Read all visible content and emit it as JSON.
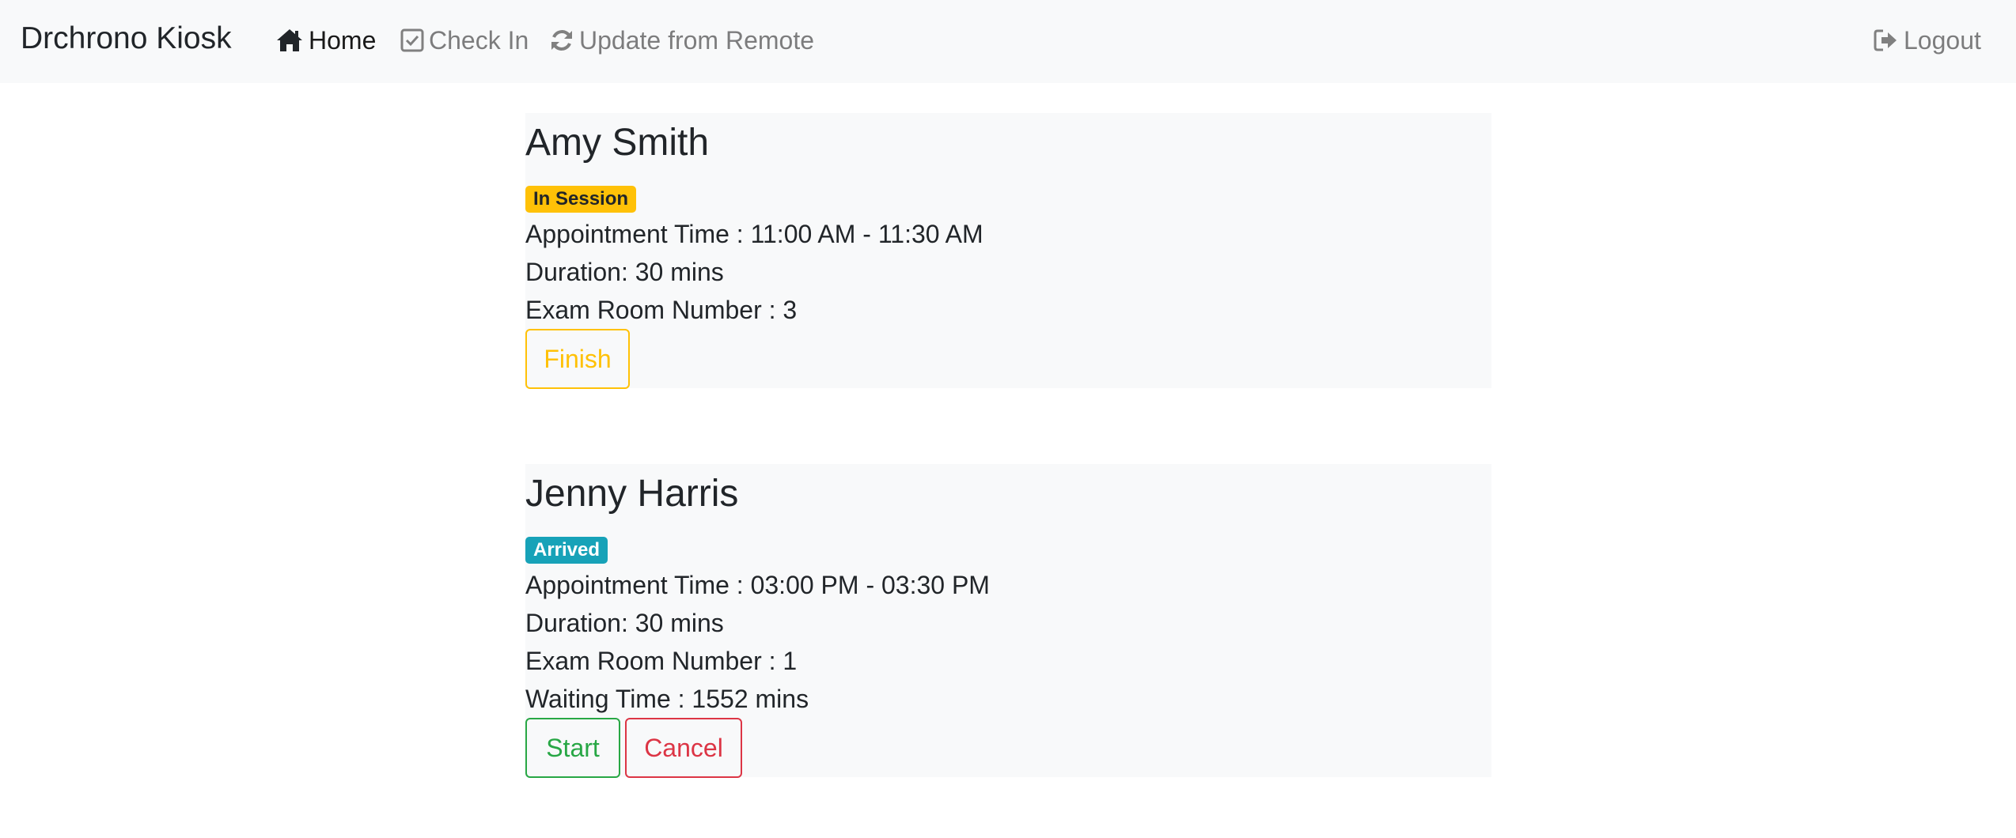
{
  "navbar": {
    "brand": "Drchrono Kiosk",
    "items": [
      {
        "label": "Home",
        "icon": "home-icon",
        "active": true
      },
      {
        "label": "Check In",
        "icon": "check-square-icon",
        "active": false
      },
      {
        "label": "Update from Remote",
        "icon": "refresh-icon",
        "active": false
      }
    ],
    "logout": {
      "label": "Logout",
      "icon": "sign-out-icon"
    }
  },
  "appointments": [
    {
      "name": "Amy Smith",
      "status": "In Session",
      "status_color": "#ffc107",
      "appointment_time": "Appointment Time : 11:00 AM - 11:30 AM",
      "duration": "Duration: 30 mins",
      "exam_room": "Exam Room Number : 3",
      "actions": [
        {
          "label": "Finish",
          "color": "#ffc107"
        }
      ]
    },
    {
      "name": "Jenny Harris",
      "status": "Arrived",
      "status_color": "#17a2b8",
      "appointment_time": "Appointment Time : 03:00 PM - 03:30 PM",
      "duration": "Duration: 30 mins",
      "exam_room": "Exam Room Number : 1",
      "waiting_time": "Waiting Time : 1552 mins",
      "actions": [
        {
          "label": "Start",
          "color": "#28a745"
        },
        {
          "label": "Cancel",
          "color": "#dc3545"
        }
      ]
    }
  ]
}
